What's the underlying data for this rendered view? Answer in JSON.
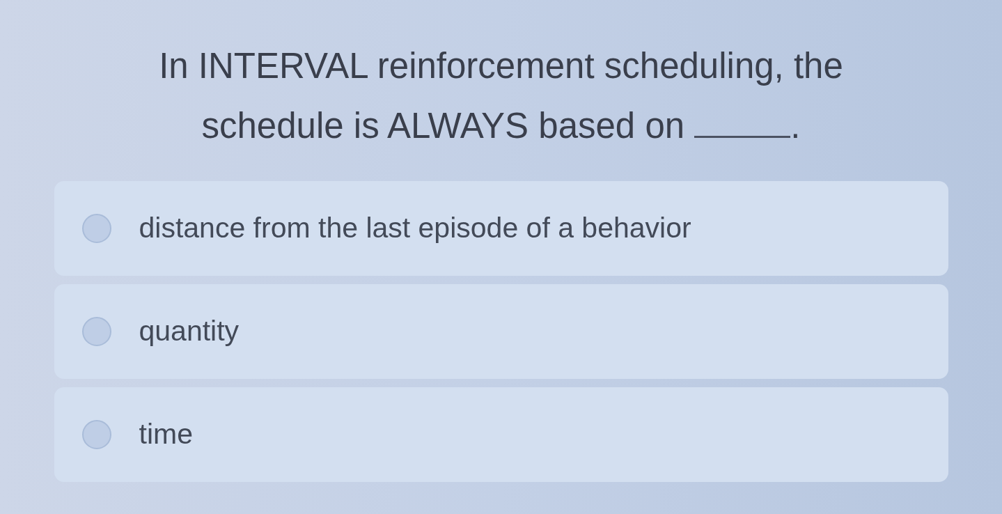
{
  "question": {
    "lines": [
      "In INTERVAL reinforcement scheduling, the",
      "schedule is ALWAYS based on"
    ],
    "after_blank": "."
  },
  "options": [
    {
      "label": "distance from the last episode of a behavior",
      "selected": false
    },
    {
      "label": "quantity",
      "selected": false
    },
    {
      "label": "time",
      "selected": false
    }
  ]
}
